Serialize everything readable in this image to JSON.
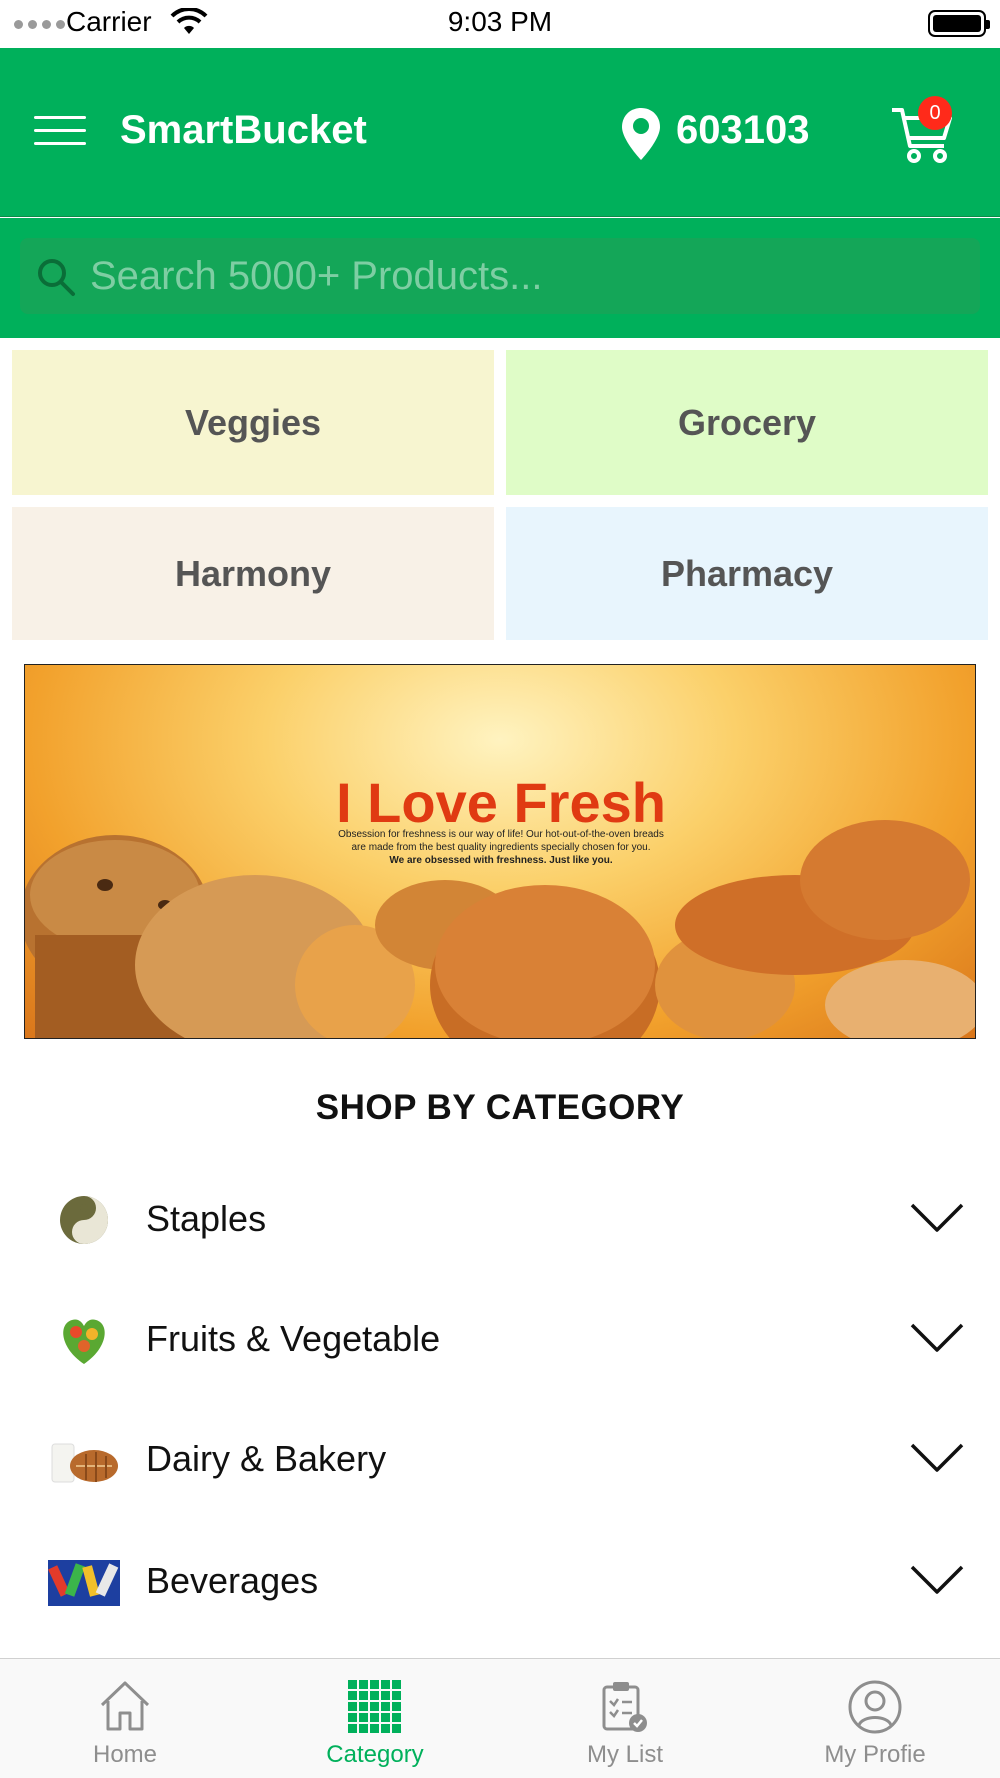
{
  "status_bar": {
    "carrier": "Carrier",
    "time": "9:03 PM"
  },
  "header": {
    "brand": "SmartBucket",
    "pincode": "603103",
    "cart_count": "0",
    "menu_icon": "hamburger-icon",
    "location_icon": "map-pin-icon",
    "cart_icon": "cart-icon"
  },
  "search": {
    "placeholder": "Search 5000+ Products...",
    "value": ""
  },
  "quick_tiles": [
    {
      "label": "Veggies",
      "color": "#f7f5d0"
    },
    {
      "label": "Grocery",
      "color": "#dffcc7"
    },
    {
      "label": "Harmony",
      "color": "#f8f1e7"
    },
    {
      "label": "Pharmacy",
      "color": "#e8f5fd"
    }
  ],
  "banner": {
    "title": "I Love Fresh",
    "line1": "Obsession for freshness is our way of life! Our hot-out-of-the-oven breads",
    "line2": "are made from the best quality ingredients specially chosen for you.",
    "line3": "We are obsessed with freshness. Just like you."
  },
  "shop_by_category": {
    "title": "SHOP BY CATEGORY",
    "items": [
      {
        "label": "Staples",
        "icon": "staples-thumb"
      },
      {
        "label": "Fruits & Vegetable",
        "icon": "fruits-vegetable-thumb"
      },
      {
        "label": "Dairy & Bakery",
        "icon": "dairy-bakery-thumb"
      },
      {
        "label": "Beverages",
        "icon": "beverages-thumb"
      }
    ]
  },
  "tabbar": {
    "items": [
      {
        "label": "Home",
        "icon": "home-icon",
        "active": false
      },
      {
        "label": "Category",
        "icon": "grid-icon",
        "active": true
      },
      {
        "label": "My List",
        "icon": "clipboard-icon",
        "active": false
      },
      {
        "label": "My Profie",
        "icon": "user-icon",
        "active": false
      }
    ]
  },
  "colors": {
    "brand_green": "#00b05b",
    "badge_red": "#ff2a1a",
    "banner_title": "#e03a12"
  }
}
